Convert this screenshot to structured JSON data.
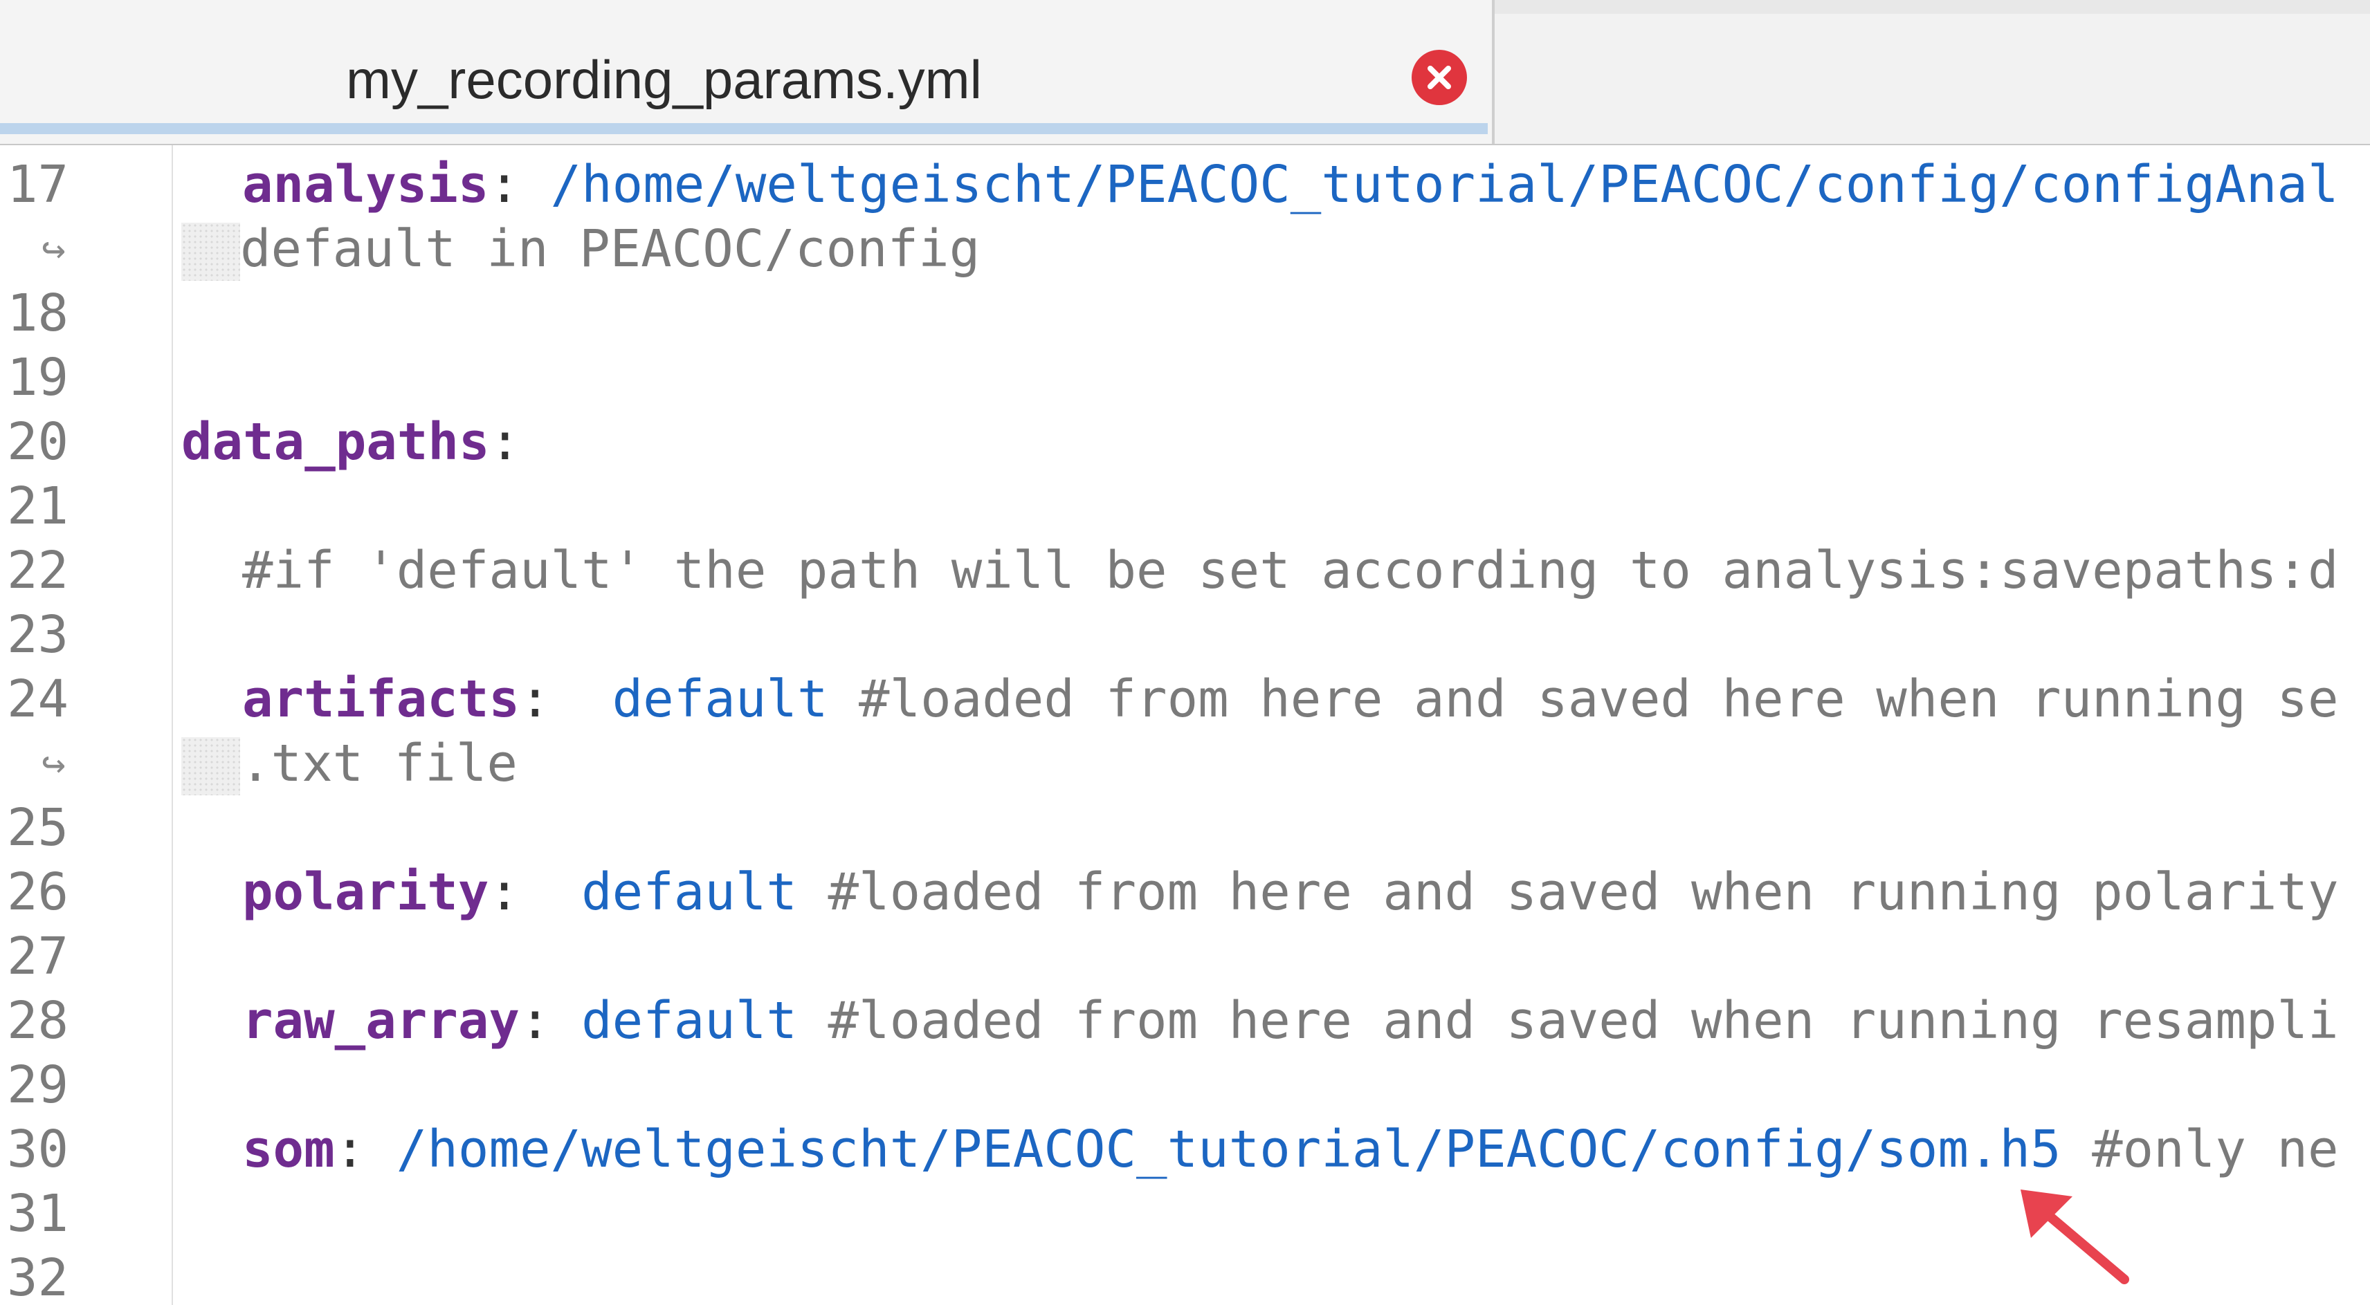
{
  "tab": {
    "title": "my_recording_params.yml"
  },
  "colors": {
    "key": "#6f2c8f",
    "value": "#1c66c2",
    "comment": "#7a7a7a",
    "close": "#e0353e",
    "arrow": "#e8434f"
  },
  "icons": {
    "close": "close-circle-icon",
    "wrap": "wrap-arrow-icon",
    "annotation": "red-arrow-icon"
  },
  "wrap_glyph": "↪",
  "lines": [
    {
      "num": "17",
      "key": "analysis",
      "punct": ":",
      "value": " /home/weltgeischt/PEACOC_tutorial/PEACOC/config/configAnal",
      "comment": ""
    },
    {
      "wrap": true,
      "text": "default in PEACOC/config"
    },
    {
      "num": "18"
    },
    {
      "num": "19"
    },
    {
      "num": "20",
      "key": "data_paths",
      "punct": ":",
      "top_level": true
    },
    {
      "num": "21"
    },
    {
      "num": "22",
      "comment": "#if 'default' the path will be set according to analysis:savepaths:d"
    },
    {
      "num": "23"
    },
    {
      "num": "24",
      "key": "artifacts",
      "punct": ":",
      "value": "  default",
      "comment": " #loaded from here and saved here when running se"
    },
    {
      "wrap": true,
      "text": ".txt file"
    },
    {
      "num": "25"
    },
    {
      "num": "26",
      "key": "polarity",
      "punct": ":",
      "value": "  default",
      "comment": " #loaded from here and saved when running polarity"
    },
    {
      "num": "27"
    },
    {
      "num": "28",
      "key": "raw_array",
      "punct": ":",
      "value": " default",
      "comment": " #loaded from here and saved when running resampli"
    },
    {
      "num": "29"
    },
    {
      "num": "30",
      "key": "som",
      "punct": ":",
      "value": " /home/weltgeischt/PEACOC_tutorial/PEACOC/config/som.h5",
      "comment": " #only ne"
    },
    {
      "num": "31"
    },
    {
      "num": "32"
    }
  ]
}
